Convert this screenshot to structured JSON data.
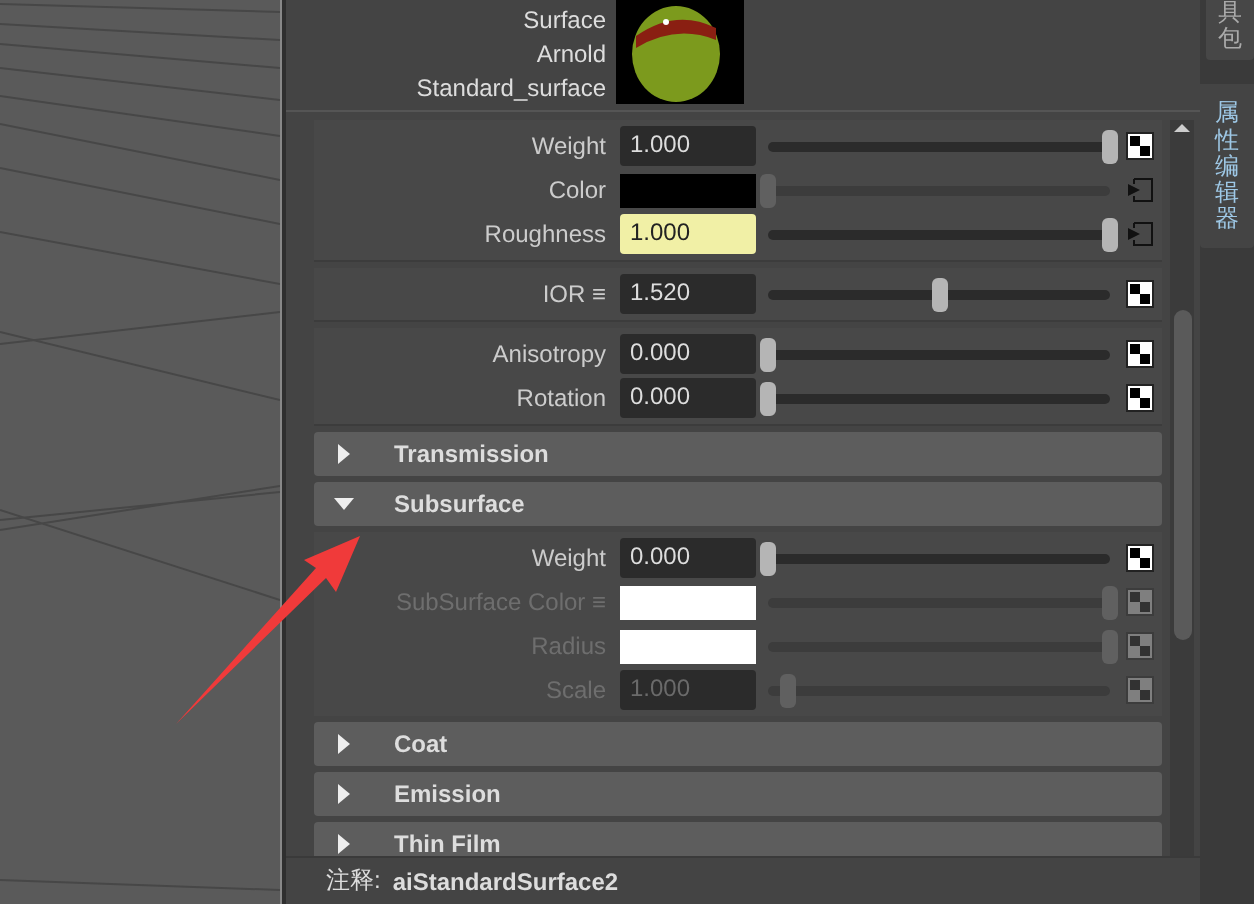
{
  "header": {
    "lines": [
      "Surface",
      "Arnold",
      "Standard_surface"
    ]
  },
  "attribute_groups": [
    {
      "rows": [
        {
          "label": "Weight",
          "kind": "number",
          "value": "1.000",
          "level": 1,
          "highlighted": false,
          "disabled": false,
          "connected": false
        },
        {
          "label": "Color",
          "kind": "color",
          "color": "#000000",
          "level": 0,
          "disabled": false,
          "connected": true
        },
        {
          "label": "Roughness",
          "kind": "number",
          "value": "1.000",
          "level": 1,
          "highlighted": true,
          "disabled": false,
          "connected": true
        }
      ]
    },
    {
      "rows": [
        {
          "label": "IOR ≡",
          "kind": "number",
          "value": "1.520",
          "level": 0.5,
          "highlighted": false,
          "disabled": false,
          "connected": false
        }
      ]
    },
    {
      "rows": [
        {
          "label": "Anisotropy",
          "kind": "number",
          "value": "0.000",
          "level": 0,
          "highlighted": false,
          "disabled": false,
          "connected": false
        },
        {
          "label": "Rotation",
          "kind": "number",
          "value": "0.000",
          "level": 0,
          "highlighted": false,
          "disabled": false,
          "connected": false
        }
      ]
    }
  ],
  "sections": [
    {
      "title": "Transmission",
      "expanded": false
    },
    {
      "title": "Subsurface",
      "expanded": true,
      "rows": [
        {
          "label": "Weight",
          "kind": "number",
          "value": "0.000",
          "level": 0,
          "highlighted": false,
          "disabled": false,
          "connected": false
        },
        {
          "label": "SubSurface Color ≡",
          "kind": "color",
          "color": "#ffffff",
          "level": 1,
          "disabled": true,
          "connected": false
        },
        {
          "label": "Radius",
          "kind": "color",
          "color": "#ffffff",
          "level": 1,
          "disabled": true,
          "connected": false
        },
        {
          "label": "Scale",
          "kind": "number",
          "value": "1.000",
          "level": 0.06,
          "highlighted": false,
          "disabled": true,
          "connected": false
        }
      ]
    },
    {
      "title": "Coat",
      "expanded": false
    },
    {
      "title": "Emission",
      "expanded": false
    },
    {
      "title": "Thin Film",
      "expanded": false
    }
  ],
  "note": {
    "label": "注释:",
    "value": "aiStandardSurface2"
  },
  "side_tabs": [
    {
      "label": "具包",
      "selected": false
    },
    {
      "label": "属性编辑器",
      "selected": true
    }
  ]
}
